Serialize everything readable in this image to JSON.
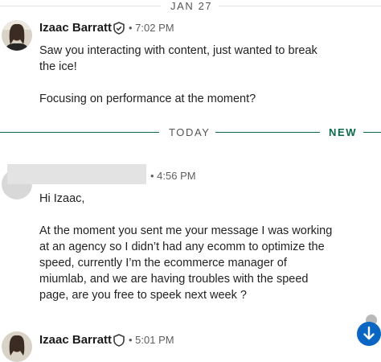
{
  "dates": {
    "jan27": "JAN 27",
    "today": "TODAY",
    "new_label": "NEW"
  },
  "messages": [
    {
      "sender": "Izaac Barratt",
      "time": "• 7:02 PM",
      "text": "Saw you interacting with content, just wanted to break\nthe ice!\n\nFocusing on performance at the moment?"
    },
    {
      "sender": "",
      "time": "• 4:56 PM",
      "text": "Hi Izaac,\n\nAt the moment you sent me your message I was working\nat an agency so I didn’t had any ecomm to optimize the\nspeed, currently I’m the ecommerce manager of\nmiumlab, and we are having troubles with the speed\npage, are you free to speek next week ?"
    },
    {
      "sender": "Izaac Barratt",
      "time": "• 5:01 PM"
    }
  ],
  "colors": {
    "accent_green": "#0b6a48",
    "fab_blue": "#0a66c2"
  },
  "icons": {
    "verified": "shield-check-icon",
    "scroll_down": "arrow-down-icon"
  }
}
